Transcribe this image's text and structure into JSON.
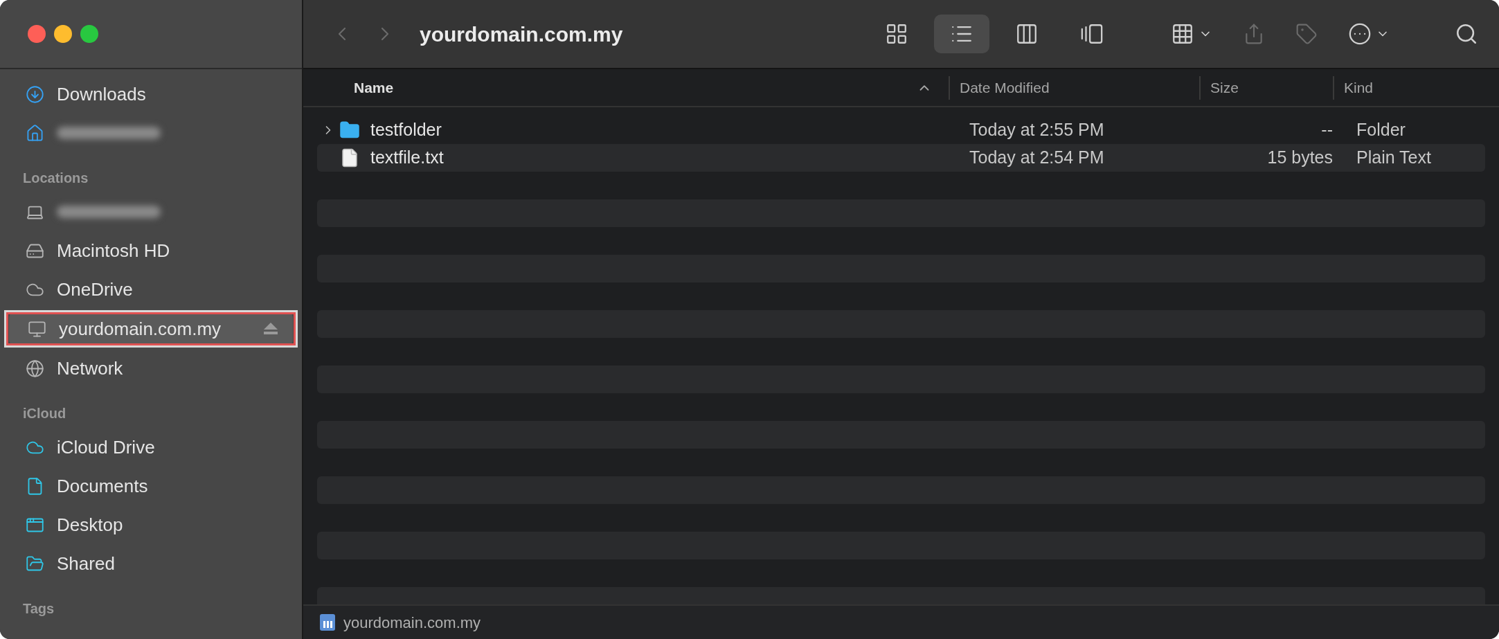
{
  "window": {
    "title": "yourdomain.com.my"
  },
  "toolbar": {
    "view_buttons": [
      {
        "selected": false
      },
      {
        "selected": true
      },
      {
        "selected": false
      },
      {
        "selected": false
      }
    ]
  },
  "sidebar": {
    "sections": [
      {
        "items": [
          {
            "label": "Downloads",
            "blurred": false,
            "selected": false,
            "annotated": false
          },
          {
            "blurred": true,
            "selected": false,
            "annotated": false
          }
        ]
      },
      {
        "header": "Locations",
        "items": [
          {
            "blurred": true,
            "selected": false,
            "annotated": false
          },
          {
            "label": "Macintosh HD",
            "blurred": false,
            "selected": false,
            "annotated": false
          },
          {
            "label": "OneDrive",
            "blurred": false,
            "selected": false,
            "annotated": false
          },
          {
            "label": "yourdomain.com.my",
            "blurred": false,
            "selected": true,
            "annotated": true,
            "ejectable": true
          },
          {
            "label": "Network",
            "blurred": false,
            "selected": false,
            "annotated": false
          }
        ]
      },
      {
        "header": "iCloud",
        "items": [
          {
            "label": "iCloud Drive",
            "blurred": false,
            "selected": false,
            "annotated": false
          },
          {
            "label": "Documents",
            "blurred": false,
            "selected": false,
            "annotated": false
          },
          {
            "label": "Desktop",
            "blurred": false,
            "selected": false,
            "annotated": false
          },
          {
            "label": "Shared",
            "blurred": false,
            "selected": false,
            "annotated": false
          }
        ]
      },
      {
        "header": "Tags"
      }
    ]
  },
  "table": {
    "columns": [
      {
        "label": "Name",
        "sorted": true
      },
      {
        "label": "Date Modified",
        "sorted": false
      },
      {
        "label": "Size",
        "sorted": false
      },
      {
        "label": "Kind",
        "sorted": false
      }
    ],
    "rows": [
      {
        "kind": "folder",
        "name": "testfolder",
        "date": "Today at 2:55 PM",
        "size": "--",
        "type": "Folder"
      },
      {
        "kind": "file",
        "name": "textfile.txt",
        "date": "Today at 2:54 PM",
        "size": "15 bytes",
        "type": "Plain Text"
      }
    ]
  },
  "status_bar": {
    "path": "yourdomain.com.my"
  }
}
